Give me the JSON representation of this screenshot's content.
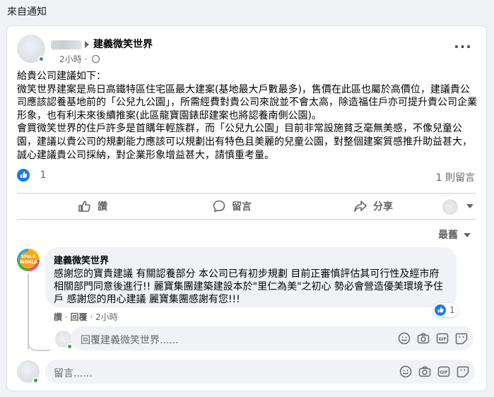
{
  "header": {
    "title": "來自通知"
  },
  "post": {
    "group": "建義微笑世界",
    "time": "2小時",
    "time_sep": "·",
    "text": "給貴公司建議如下：\n微笑世界建案是烏日高鐵特區住宅區最大建案(基地最大戶數最多)，售價在此區也屬於高價位，建議貴公司應該認養基地前的「公兒九公園」，所需經費對貴公司來說並不會太高，除造福住戶亦可提升貴公司企業形象，也有利未來後續推案(此區龍寶園錶邸建案也將認養南側公園)。\n會買微笑世界的住戶許多是首購年輕族群，而「公兒九公園」目前非常設施貧乏毫無美感，不像兒童公園，建議以貴公司的規劃能力應該可以規劃出有特色且美麗的兒童公園，對整個建案質感推升助益甚大，誠心建議貴公司採納，對企業形象增益甚大，請慎重考量。",
    "reaction_count": "1",
    "comment_count": "1 則留言"
  },
  "actions": {
    "like": "讚",
    "comment": "留言",
    "share": "分享"
  },
  "sort": {
    "label": "最舊"
  },
  "comment": {
    "author": "建義微笑世界",
    "avatar_text": "SMILE WORLD",
    "text": "感謝您的寶貴建議 有關認養部分 本公司已有初步規劃 目前正審慎評估其可行性及經市府相關部門同意後進行!! 麗寶集團建築建設本於\"里仁為美\"之初心 勢必會營造優美環境予住戶 感謝您的用心建議 麗寶集團感謝有您!!!",
    "like": "讚",
    "reply": "回覆",
    "sep": "·",
    "time": "2小時",
    "reaction_count": "1"
  },
  "reply_input": {
    "placeholder": "回覆建義微笑世界......"
  },
  "main_input": {
    "placeholder": "留言......"
  },
  "colors": {
    "accent": "#1877f2",
    "online": "#31a24c",
    "muted": "#65676b"
  }
}
